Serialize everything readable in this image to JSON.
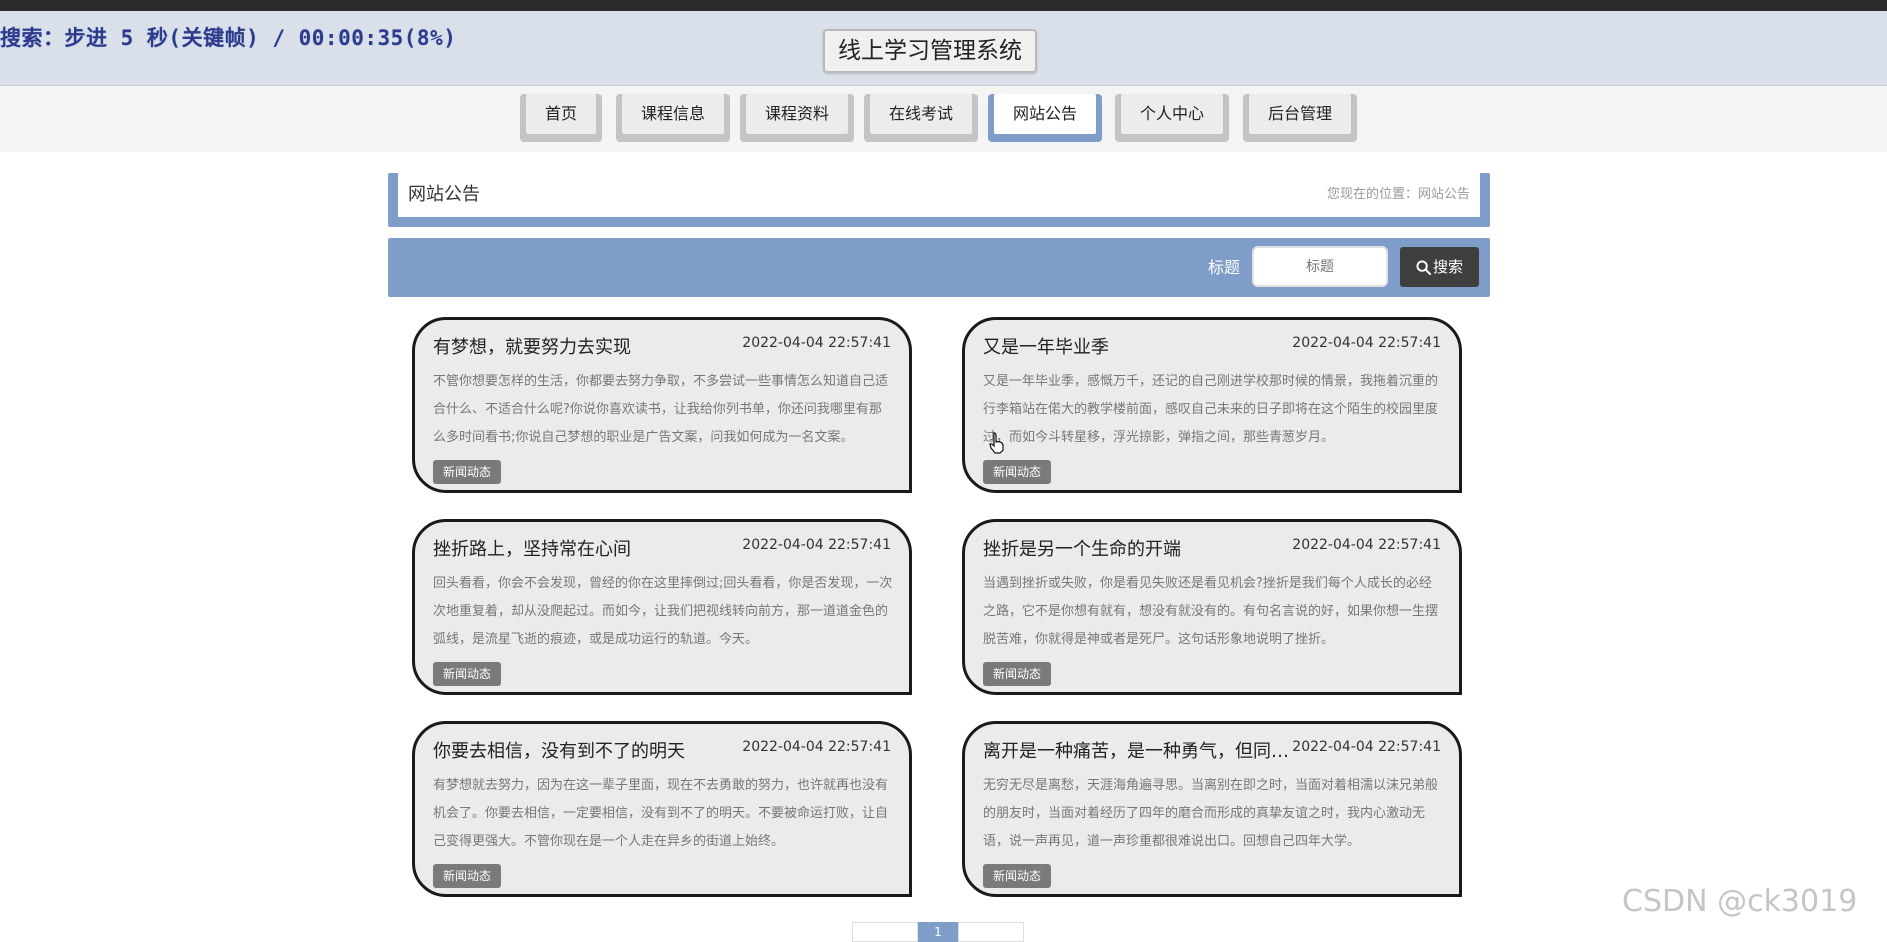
{
  "overlay": {
    "text": "搜索：步进 5 秒(关键帧) / 00:00:35(8%)"
  },
  "site": {
    "title": "线上学习管理系统"
  },
  "nav": {
    "items": [
      {
        "label": "首页"
      },
      {
        "label": "课程信息"
      },
      {
        "label": "课程资料"
      },
      {
        "label": "在线考试"
      },
      {
        "label": "网站公告",
        "active": true
      },
      {
        "label": "个人中心"
      },
      {
        "label": "后台管理"
      }
    ]
  },
  "breadcrumb": {
    "title": "网站公告",
    "location": "您现在的位置：网站公告"
  },
  "search": {
    "label": "标题",
    "placeholder": "标题",
    "button": "搜索"
  },
  "cards": [
    {
      "title": "有梦想，就要努力去实现",
      "date": "2022-04-04 22:57:41",
      "body": "不管你想要怎样的生活，你都要去努力争取，不多尝试一些事情怎么知道自己适合什么、不适合什么呢?你说你喜欢读书，让我给你列书单，你还问我哪里有那么多时间看书;你说自己梦想的职业是广告文案，问我如何成为一名文案。",
      "tag": "新闻动态"
    },
    {
      "title": "又是一年毕业季",
      "date": "2022-04-04 22:57:41",
      "body": "又是一年毕业季，感慨万千，还记的自己刚进学校那时候的情景，我拖着沉重的行李箱站在偌大的教学楼前面，感叹自己未来的日子即将在这个陌生的校园里度过，而如今斗转星移，浮光掠影，弹指之间，那些青葱岁月。",
      "tag": "新闻动态"
    },
    {
      "title": "挫折路上，坚持常在心间",
      "date": "2022-04-04 22:57:41",
      "body": "回头看看，你会不会发现，曾经的你在这里摔倒过;回头看看，你是否发现，一次次地重复着，却从没爬起过。而如今，让我们把视线转向前方，那一道道金色的弧线，是流星飞逝的痕迹，或是成功运行的轨道。今天。",
      "tag": "新闻动态"
    },
    {
      "title": "挫折是另一个生命的开端",
      "date": "2022-04-04 22:57:41",
      "body": "当遇到挫折或失败，你是看见失败还是看见机会?挫折是我们每个人成长的必经之路，它不是你想有就有，想没有就没有的。有句名言说的好，如果你想一生摆脱苦难，你就得是神或者是死尸。这句话形象地说明了挫折。",
      "tag": "新闻动态"
    },
    {
      "title": "你要去相信，没有到不了的明天",
      "date": "2022-04-04 22:57:41",
      "body": "有梦想就去努力，因为在这一辈子里面，现在不去勇敢的努力，也许就再也没有机会了。你要去相信，一定要相信，没有到不了的明天。不要被命运打败，让自己变得更强大。不管你现在是一个人走在异乡的街道上始终。",
      "tag": "新闻动态"
    },
    {
      "title": "离开是一种痛苦，是一种勇气，但同样也是一个考验",
      "date": "2022-04-04 22:57:41",
      "body": "无穷无尽是离愁，天涯海角遍寻思。当离别在即之时，当面对着相濡以沫兄弟般的朋友时，当面对着经历了四年的磨合而形成的真挚友谊之时，我内心激动无语，说一声再见，道一声珍重都很难说出口。回想自己四年大学。",
      "tag": "新闻动态"
    }
  ],
  "pager": {
    "current": "1"
  },
  "watermark": "CSDN @ck3019"
}
